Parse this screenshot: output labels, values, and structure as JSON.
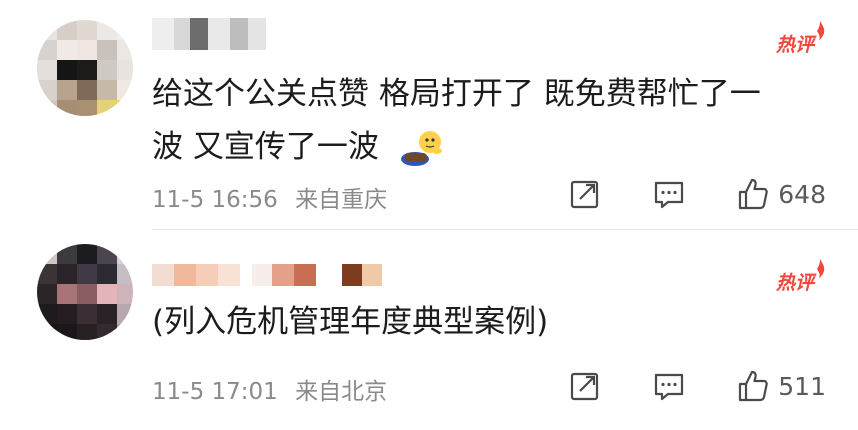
{
  "comments": [
    {
      "badge": "热评",
      "text_line1": "给这个公关点赞  格局打开了  既免费帮忙了一",
      "text_line2": "波  又宣传了一波",
      "emoji": "doge-lying-emoji",
      "date": "11-5 16:56",
      "location": "来自重庆",
      "likes": "648"
    },
    {
      "badge": "热评",
      "text_line1": "(列入危机管理年度典型案例)",
      "date": "11-5 17:01",
      "location": "来自北京",
      "likes": "511"
    }
  ],
  "colors": {
    "hot_badge": "#f2473c",
    "meta_text": "#8a8a8a",
    "body_text": "#1c1c1c"
  },
  "icons": [
    "share-icon",
    "reply-icon",
    "like-icon",
    "flame-icon"
  ]
}
